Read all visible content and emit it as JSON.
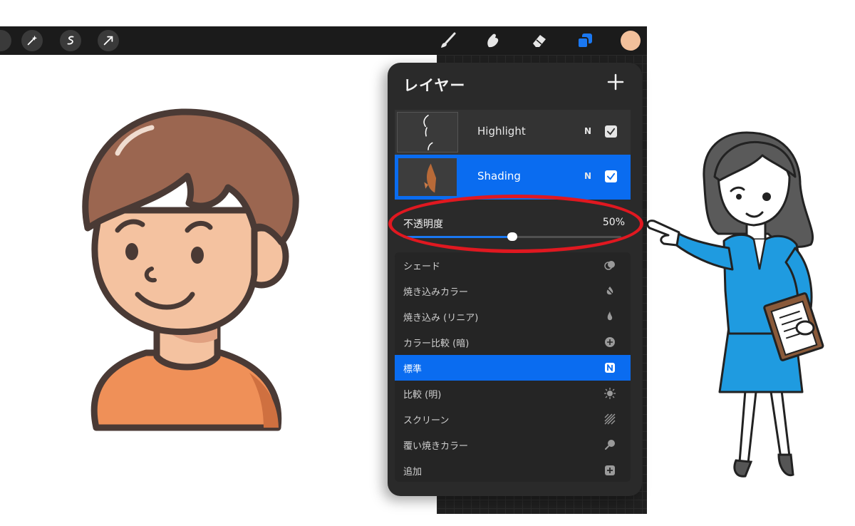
{
  "toolbar": {
    "left_tools": [
      "adjust-icon",
      "selection-icon",
      "transform-icon"
    ],
    "right_tools": [
      "brush-icon",
      "smudge-icon",
      "eraser-icon",
      "layers-icon"
    ],
    "active_tool": "layers-icon",
    "color_swatch": "#f2c09b"
  },
  "panel": {
    "title": "レイヤー",
    "add_icon": "plus-icon",
    "layers": [
      {
        "name": "Highlight",
        "mode": "N",
        "visible": true,
        "selected": false
      },
      {
        "name": "Shading",
        "mode": "N",
        "visible": true,
        "selected": true
      }
    ],
    "opacity": {
      "label": "不透明度",
      "value_text": "50%",
      "value": 0.5
    },
    "blend_modes": [
      {
        "label": "シェード",
        "icon": "overlap-circles-icon",
        "active": false
      },
      {
        "label": "焼き込みカラー",
        "icon": "burn-icon",
        "active": false
      },
      {
        "label": "焼き込み (リニア)",
        "icon": "flame-icon",
        "active": false
      },
      {
        "label": "カラー比較 (暗)",
        "icon": "plus-circle-icon",
        "active": false
      },
      {
        "label": "標準",
        "icon": "n-badge-icon",
        "badge": "N",
        "active": true
      },
      {
        "label": "比較 (明)",
        "icon": "sunburst-icon",
        "active": false
      },
      {
        "label": "スクリーン",
        "icon": "hatch-icon",
        "active": false
      },
      {
        "label": "覆い焼きカラー",
        "icon": "pin-icon",
        "active": false
      },
      {
        "label": "追加",
        "icon": "plus-square-icon",
        "active": false
      }
    ]
  },
  "colors": {
    "accent": "#0a6cf0",
    "panel_bg": "#2a2a2a",
    "highlight_ellipse": "#e01820"
  }
}
